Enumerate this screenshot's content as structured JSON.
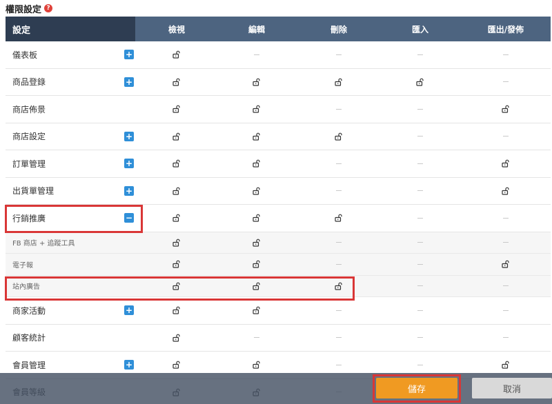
{
  "page": {
    "title": "權限設定",
    "help_icon": "?"
  },
  "table": {
    "first_header": "設定",
    "headers": [
      "檢視",
      "編輯",
      "刪除",
      "匯入",
      "匯出/發佈"
    ],
    "rows": [
      {
        "label": "儀表板",
        "toggle": "+",
        "perms": [
          true,
          false,
          false,
          false,
          false
        ],
        "sub": false
      },
      {
        "label": "商品登錄",
        "toggle": "+",
        "perms": [
          true,
          true,
          true,
          true,
          false
        ],
        "sub": false
      },
      {
        "label": "商店佈景",
        "toggle": "",
        "perms": [
          true,
          true,
          false,
          false,
          true
        ],
        "sub": false
      },
      {
        "label": "商店設定",
        "toggle": "+",
        "perms": [
          true,
          true,
          true,
          false,
          false
        ],
        "sub": false
      },
      {
        "label": "訂單管理",
        "toggle": "+",
        "perms": [
          true,
          true,
          false,
          false,
          true
        ],
        "sub": false
      },
      {
        "label": "出貨單管理",
        "toggle": "+",
        "perms": [
          true,
          true,
          false,
          false,
          true
        ],
        "sub": false
      },
      {
        "label": "行銷推廣",
        "toggle": "−",
        "perms": [
          true,
          true,
          true,
          false,
          false
        ],
        "sub": false
      },
      {
        "label": "FB 商店 + 追蹤工具",
        "toggle": "",
        "perms": [
          true,
          true,
          false,
          false,
          false
        ],
        "sub": true
      },
      {
        "label": "電子報",
        "toggle": "",
        "perms": [
          true,
          true,
          false,
          false,
          true
        ],
        "sub": true
      },
      {
        "label": "站內廣告",
        "toggle": "",
        "perms": [
          true,
          true,
          true,
          false,
          false
        ],
        "sub": true
      },
      {
        "label": "商家活動",
        "toggle": "+",
        "perms": [
          true,
          true,
          false,
          false,
          false
        ],
        "sub": false
      },
      {
        "label": "顧客統計",
        "toggle": "",
        "perms": [
          true,
          false,
          false,
          false,
          false
        ],
        "sub": false
      },
      {
        "label": "會員管理",
        "toggle": "+",
        "perms": [
          true,
          true,
          false,
          false,
          true
        ],
        "sub": false
      },
      {
        "label": "會員等級",
        "toggle": "",
        "perms": [
          true,
          true,
          false,
          false,
          false
        ],
        "sub": false
      }
    ]
  },
  "footer": {
    "save_label": "儲存",
    "cancel_label": "取消"
  },
  "colors": {
    "header_dark": "#2e3d52",
    "header": "#4d6480",
    "accent_blue": "#2f8fd8",
    "save": "#f09a22",
    "highlight": "#d93636"
  },
  "icons": {
    "permission": "unlock-icon",
    "none": "dash-icon"
  }
}
